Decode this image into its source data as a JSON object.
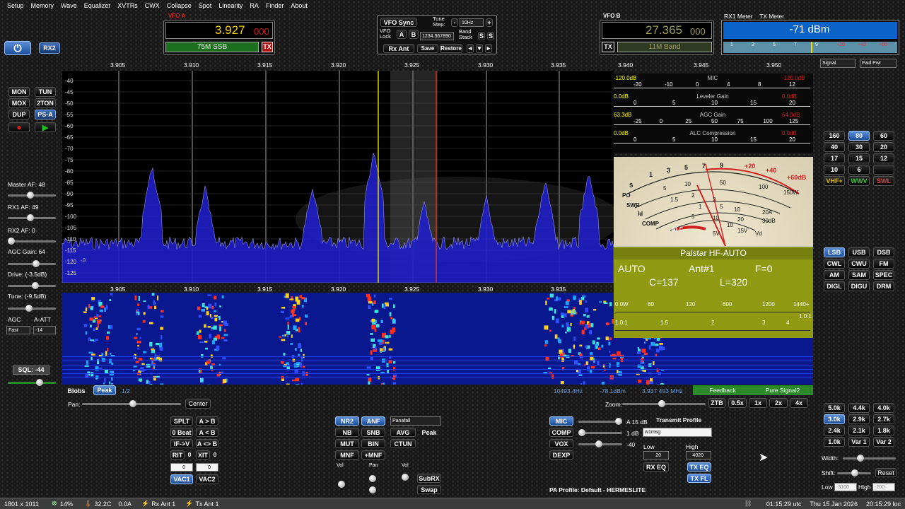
{
  "menu": [
    "Setup",
    "Memory",
    "Wave",
    "Equalizer",
    "XVTRs",
    "CWX",
    "Collapse",
    "Spot",
    "Linearity",
    "RA",
    "Finder",
    "About"
  ],
  "vfoA": {
    "title": "VFO A",
    "freq": "3.927",
    "freq_sub": "000",
    "band": "75M SSB",
    "tx": "TX"
  },
  "vfoB": {
    "title": "VFO B",
    "freq": "27.365",
    "freq_sub": "000",
    "band": "11M Band",
    "tx": "TX"
  },
  "vfo_center": {
    "sync": "VFO Sync",
    "lock": "VFO Lock",
    "a": "A",
    "b": "B",
    "tune_step": "Tune Step:",
    "minus": "-",
    "plus": "+",
    "step_value": "10Hz",
    "freq_entry": "1234.567890",
    "band_stack": "Band Stack",
    "save": "Save",
    "restore": "Restore",
    "rx_ant": "Rx Ant",
    "stack_s1": "S",
    "stack_s2": "S"
  },
  "rx1meter": {
    "label1": "RX1 Meter",
    "label2": "TX Meter",
    "value": "-71 dBm",
    "ticks": [
      "1",
      "3",
      "5",
      "7",
      "9",
      "+20",
      "+40",
      "+60"
    ],
    "sel1": "Signal",
    "sel2": "Fwd Pwr"
  },
  "left_top": {
    "power": "⏻",
    "rx2": "RX2"
  },
  "left_buttons": [
    "MON",
    "TUN",
    "MOX",
    "2TON",
    "DUP",
    "PS-A"
  ],
  "left_controls": {
    "master": "Master AF:  48",
    "rx1": "RX1 AF:  49",
    "rx2": "RX2 AF:  0",
    "agc_gain": "AGC Gain:  64",
    "drive": "Drive:  (-3.5dB)",
    "tune": "Tune:  (-9.5dB)",
    "agc": "AGC",
    "aatt": "A-ATT",
    "agc_mode": "Fast",
    "aatt_val": "-14",
    "sql": "SQL:  -44"
  },
  "freq_ticks": [
    "3.905",
    "3.910",
    "3.915",
    "3.920",
    "3.925",
    "3.930",
    "3.935",
    "3.940",
    "3.945",
    "3.950"
  ],
  "db_ticks": [
    "-40",
    "-45",
    "-50",
    "-55",
    "-60",
    "-65",
    "-70",
    "-75",
    "-80",
    "-85",
    "-90",
    "-95",
    "-100",
    "-105",
    "-110",
    "-115",
    "-120",
    "-125"
  ],
  "spectrum_marker": "-0",
  "info_bar": {
    "blobs": "Blobs",
    "peak": "Peak",
    "half": "1/2",
    "hz": "10493.4Hz",
    "db": "-78.1dBm",
    "mhz": "3.937 493 MHz",
    "feedback": "Feedback",
    "pure": "Pure Signal2"
  },
  "tx_meters": [
    {
      "left": "-120.0dB",
      "title": "MIC",
      "right": "-120.0dB",
      "ticks": [
        "-20",
        "-10",
        "0",
        "4",
        "8",
        "12"
      ]
    },
    {
      "left": "0.0dB",
      "title": "Leveler Gain",
      "right": "0.0dB",
      "ticks": [
        "0",
        "5",
        "10",
        "15",
        "20"
      ]
    },
    {
      "left": "63.3dB",
      "title": "AGC Gain",
      "right": "64.0dB",
      "ticks": [
        "-25",
        "0",
        "25",
        "50",
        "75",
        "100",
        "125"
      ]
    },
    {
      "left": "0.0dB",
      "title": "ALC Compression",
      "right": "0.0dB",
      "ticks": [
        "0",
        "5",
        "10",
        "15",
        "20"
      ]
    }
  ],
  "analog": {
    "s_ticks": [
      "1",
      "3",
      "5",
      "7",
      "9",
      "+20",
      "+40",
      "+60dB"
    ],
    "labels": [
      "S",
      "PO",
      "SWR",
      "Id",
      "COMP",
      "ALC"
    ],
    "scale_vals": [
      "5",
      "10",
      "50",
      "100",
      "150W",
      "1.5",
      "2",
      "3",
      "1",
      "5",
      "10",
      "20A",
      "5",
      "10",
      "20",
      "30dB",
      "5V",
      "10",
      "15V",
      "Vd"
    ]
  },
  "palstar": {
    "title": "Palstar  HF-AUTO",
    "mode": "AUTO",
    "ant": "Ant#1",
    "f": "F=0",
    "c": "C=137",
    "l": "L=320",
    "pwr": [
      "0.0W",
      "60",
      "120",
      "600",
      "1200",
      "1440+"
    ],
    "swr": [
      "1.0:1",
      "1.5",
      "2",
      "3",
      "4",
      "1.0:1"
    ]
  },
  "bands": [
    "160",
    "80",
    "60",
    "40",
    "30",
    "20",
    "17",
    "15",
    "12",
    "10",
    "6",
    "",
    "VHF+",
    "WWV",
    "SWL"
  ],
  "modes": [
    "LSB",
    "USB",
    "DSB",
    "CWL",
    "CWU",
    "FM",
    "AM",
    "SAM",
    "SPEC",
    "DIGL",
    "DIGU",
    "DRM"
  ],
  "filters": [
    "5.0k",
    "4.4k",
    "4.0k",
    "3.0k",
    "2.9k",
    "2.7k",
    "2.4k",
    "2.1k",
    "1.8k",
    "1.0k",
    "Var 1",
    "Var 2"
  ],
  "filter_controls": {
    "width": "Width:",
    "shift": "Shift:",
    "reset": "Reset",
    "low": "Low",
    "high": "High",
    "low_val": "-3100",
    "high_val": "-200"
  },
  "zoom": {
    "label": "Zoom:",
    "ztb": "ZTB",
    "x05": "0.5x",
    "x1": "1x",
    "x2": "2x",
    "x4": "4x"
  },
  "pan": {
    "label": "Pan:",
    "center": "Center"
  },
  "vfo_ops": [
    "SPLT",
    "A > B",
    "0 Beat",
    "A < B",
    "IF->V",
    "A <> B",
    "RIT",
    "0",
    "XIT",
    "0"
  ],
  "vac": {
    "vac1": "VAC1",
    "vac2": "VAC2",
    "v1": "0",
    "v2": "0"
  },
  "dsp": {
    "nr2": "NR2",
    "anf": "ANF",
    "nb": "NB",
    "snb": "SNB",
    "mut": "MUT",
    "bin": "BIN",
    "mnf": "MNF",
    "pmnf": "+MNF",
    "disp": "Panafall",
    "avg": "AVG",
    "peak": "Peak",
    "ctun": "CTUN",
    "vol": "Vol",
    "pan": "Pan",
    "vol2": "Vol",
    "subrx": "SubRX",
    "swap": "Swap"
  },
  "tx": {
    "mic": "MIC",
    "comp": "COMP",
    "vox": "VOX",
    "dexp": "DEXP",
    "a15": "A 15 dB",
    "db1": "1 dB",
    "m40": "-40",
    "profile_lbl": "Transmit Profile",
    "profile": "w1msg",
    "low": "Low",
    "high": "High",
    "low_val": "20",
    "high_val": "4020",
    "rxeq": "RX EQ",
    "txeq": "TX EQ",
    "txfl": "TX FL",
    "pa": "PA Profile: Default - HERMESLITE"
  },
  "status": {
    "res": "1801 x 1011",
    "cpu": "14%",
    "temp": "32.2C",
    "amps": "0.0A",
    "rxant": "Rx Ant 1",
    "txant": "Tx Ant 1",
    "utc": "01:15:29 utc",
    "date": "Thu 15 Jan 2026",
    "local": "20:15:29 loc"
  },
  "colors": {
    "vfo_freq": "#f4d000",
    "vfo_band_bg": "#1c6f1c",
    "spectrum": "#1a1ad0",
    "meter_blue": "#0b63c8",
    "palstar_bg": "#8f9a12"
  }
}
